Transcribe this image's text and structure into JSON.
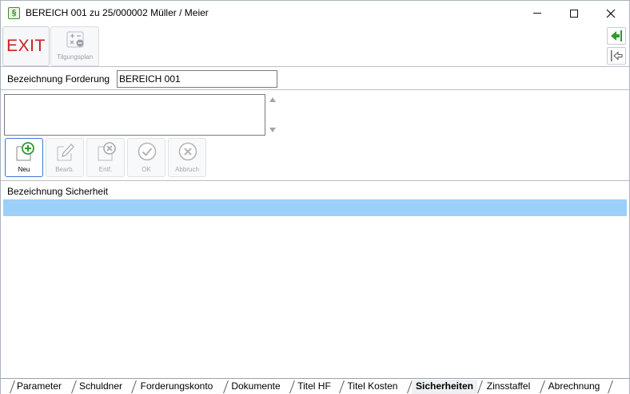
{
  "window": {
    "title": "BEREICH 001 zu 25/000002 Müller / Meier",
    "app_icon_glyph": "§"
  },
  "toolbar": {
    "exit_label": "EXIT",
    "tilgungsplan_label": "Tilgungsplan"
  },
  "forderung": {
    "label": "Bezeichnung Forderung",
    "value": "BEREICH 001"
  },
  "record_buttons": {
    "neu": "Neu",
    "bearb": "Bearb.",
    "entf": "Entf.",
    "ok": "OK",
    "abbruch": "Abbruch"
  },
  "sicherheiten_list": {
    "header": "Bezeichnung Sicherheit",
    "selected_row_color": "#9ccffa"
  },
  "tabs": [
    {
      "label": "Parameter"
    },
    {
      "label": "Schuldner"
    },
    {
      "label": "Forderungskonto"
    },
    {
      "label": "Dokumente"
    },
    {
      "label": "Titel HF"
    },
    {
      "label": "Titel Kosten"
    },
    {
      "label": "Sicherheiten",
      "active": true
    },
    {
      "label": "Zinsstaffel"
    },
    {
      "label": "Abrechnung"
    }
  ],
  "colors": {
    "exit_red": "#cc1f1f",
    "nav_green": "#2e9a2e",
    "selection_blue": "#9ccffa",
    "focus_border": "#3a78d6"
  }
}
